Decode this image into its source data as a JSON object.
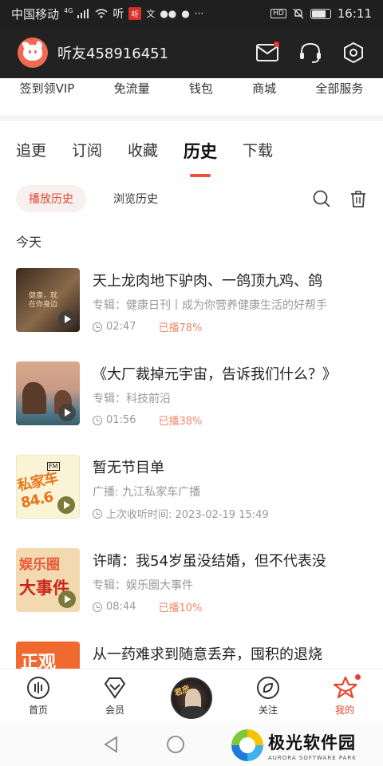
{
  "status_bar": {
    "carrier": "中国移动",
    "network": "4G",
    "app_badge": "听",
    "hd": "HD",
    "time": "16:11"
  },
  "header": {
    "username": "听友458916451"
  },
  "services": [
    "签到领VIP",
    "免流量",
    "钱包",
    "商城",
    "全部服务"
  ],
  "tabs": [
    {
      "label": "追更",
      "active": false
    },
    {
      "label": "订阅",
      "active": false
    },
    {
      "label": "收藏",
      "active": false
    },
    {
      "label": "历史",
      "active": true
    },
    {
      "label": "下载",
      "active": false
    }
  ],
  "subtabs": {
    "play_history": "播放历史",
    "browse_history": "浏览历史"
  },
  "section_label": "今天",
  "items": [
    {
      "title": "天上龙肉地下驴肉、一鸽顶九鸡、鸽",
      "album": "专辑：健康日刊丨成为你营养健康生活的好帮手",
      "duration": "02:47",
      "played": "已播78%",
      "thumb_text": "健康，就\n在你身边"
    },
    {
      "title": "《大厂裁掉元宇宙，告诉我们什么？》",
      "album": "专辑：科技前沿",
      "duration": "01:56",
      "played": "已播38%"
    },
    {
      "title": "暂无节目单",
      "album": "广播: 九江私家车广播",
      "duration": "上次收听时间: 2023-02-19 15:49",
      "played": "",
      "thumb_text": "私家车84.6",
      "thumb_fm": "FM"
    },
    {
      "title": "许晴：我54岁虽没结婚，但不代表没",
      "album": "专辑：娱乐圈大事件",
      "duration": "08:44",
      "played": "已播10%",
      "thumb_text_1": "娱乐圈",
      "thumb_text_2": "大事件"
    },
    {
      "title": "从一药难求到随意丢弃，囤积的退烧",
      "album": "",
      "duration": "",
      "played": ""
    }
  ],
  "bottom_nav": [
    {
      "label": "首页",
      "icon": "home-icon"
    },
    {
      "label": "会员",
      "icon": "vip-icon"
    },
    {
      "label": "",
      "icon": "now-playing-disc"
    },
    {
      "label": "关注",
      "icon": "follow-icon"
    },
    {
      "label": "我的",
      "icon": "mine-icon",
      "active": true
    }
  ],
  "watermark": {
    "cn": "极光软件园",
    "en": "AURORA SOFTWARE PARK"
  },
  "colors": {
    "accent": "#e8452f",
    "header_bg": "#222222",
    "played": "#f08a6a"
  }
}
